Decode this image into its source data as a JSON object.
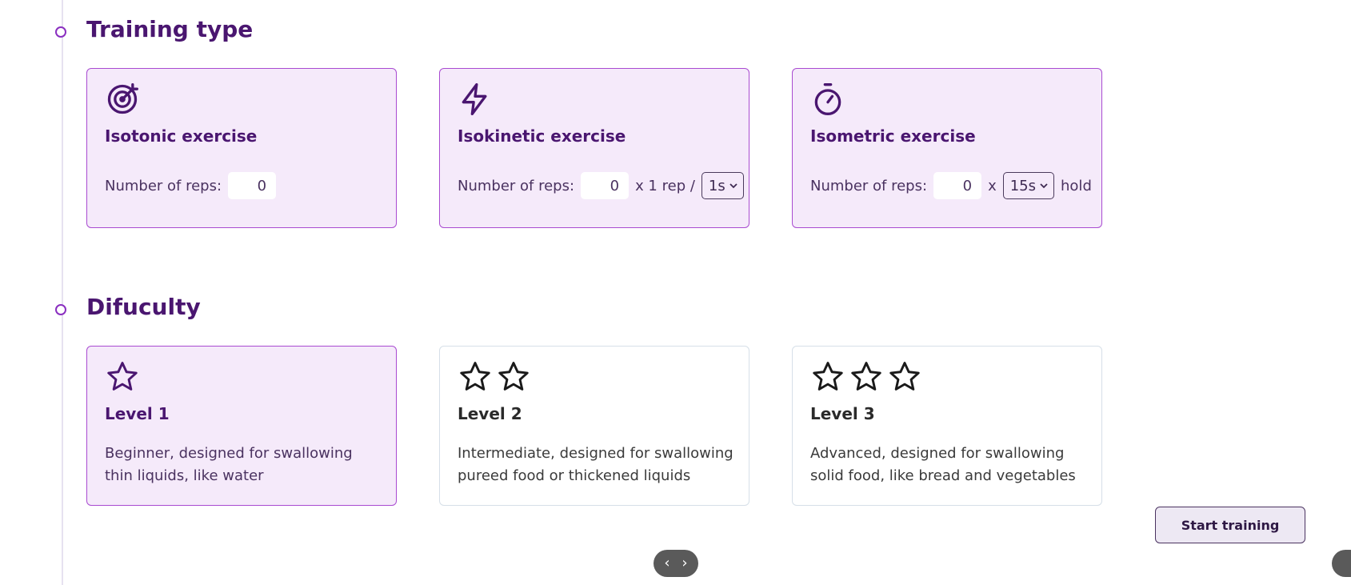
{
  "training": {
    "heading": "Training type",
    "cards": [
      {
        "title": "Isotonic exercise",
        "reps_label": "Number of reps:",
        "reps_value": "0",
        "selected": true,
        "icon": "target-icon"
      },
      {
        "title": "Isokinetic exercise",
        "reps_label": "Number of reps:",
        "reps_value": "0",
        "middle_text": "x 1 rep /",
        "select_value": "1s",
        "selected": true,
        "icon": "lightning-icon"
      },
      {
        "title": "Isometric exercise",
        "reps_label": "Number of reps:",
        "reps_value": "0",
        "middle_text": "x",
        "select_value": "15s",
        "suffix": "hold",
        "selected": true,
        "icon": "stopwatch-icon"
      }
    ]
  },
  "difficulty": {
    "heading": "Difuculty",
    "levels": [
      {
        "title": "Level 1",
        "stars": 1,
        "description": "Beginner, designed for swallowing thin liquids, like water",
        "selected": true
      },
      {
        "title": "Level 2",
        "stars": 2,
        "description": "Intermediate, designed for swallowing pureed food or thickened liquids",
        "selected": false
      },
      {
        "title": "Level 3",
        "stars": 3,
        "description": "Advanced, designed for swallowing solid food, like bread and vegetables",
        "selected": false
      }
    ]
  },
  "actions": {
    "start_label": "Start training"
  },
  "pager": {
    "prev": "‹",
    "next": "›"
  },
  "colors": {
    "accent": "#8a2fc0",
    "heading": "#4a1670",
    "selected_bg": "#f5eafa"
  }
}
